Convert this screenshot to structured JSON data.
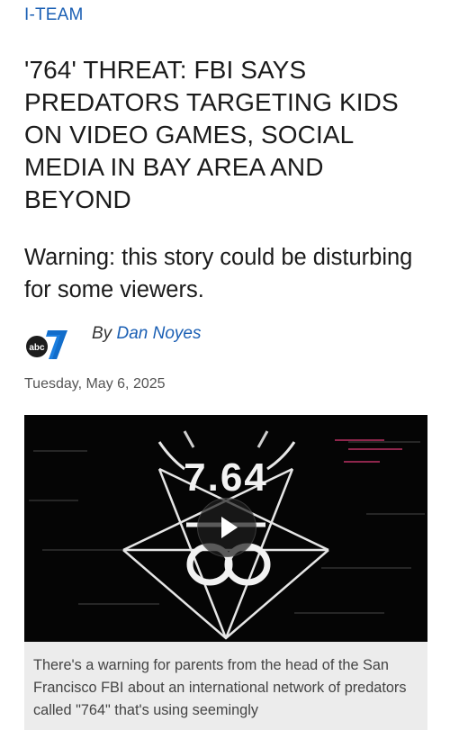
{
  "section": {
    "label": "I-TEAM"
  },
  "article": {
    "headline": "'764' THREAT: FBI SAYS PREDATORS TARGETING KIDS ON VIDEO GAMES, SOCIAL MEDIA IN BAY AREA AND BEYOND",
    "warning": "Warning: this story could be disturbing for some viewers.",
    "byline_prefix": "By",
    "author": "Dan Noyes",
    "date": "Tuesday, May 6, 2025",
    "station_logo": {
      "icon": "abc7-logo",
      "text": "abc",
      "number": "7"
    }
  },
  "video": {
    "overlay_title": "7.64",
    "play_icon": "play-icon",
    "caption": "There's a warning for parents from the head of the San Francisco FBI about an international network of predators called \"764\" that's using seemingly"
  },
  "colors": {
    "link": "#1a5fb4",
    "caption_bg": "#ececec",
    "video_bg": "#050505"
  }
}
